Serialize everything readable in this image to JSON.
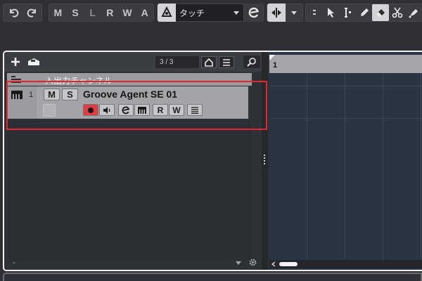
{
  "toolbar": {
    "undo_icon": "undo-icon",
    "redo_icon": "redo-icon",
    "modes": [
      "M",
      "S",
      "L",
      "R",
      "W",
      "A"
    ],
    "automation_mode": "タッチ",
    "tools": [
      "object-select-icon",
      "range-select-icon",
      "pencil-icon",
      "eraser-icon",
      "scissors-icon",
      "glue-icon"
    ]
  },
  "track_list": {
    "track_count": "3 / 3",
    "io_channel_label": "入出力チャンネル",
    "tracks": [
      {
        "number": "1",
        "mute_label": "M",
        "solo_label": "S",
        "name": "Groove Agent SE 01",
        "read_label": "R",
        "write_label": "W"
      }
    ],
    "footer_dash": "-"
  },
  "arranger": {
    "ruler_first_bar": "1"
  },
  "colors": {
    "record_active": "#e03c44",
    "highlight_box": "#e4262e",
    "arranger_background": "#2a3544"
  }
}
